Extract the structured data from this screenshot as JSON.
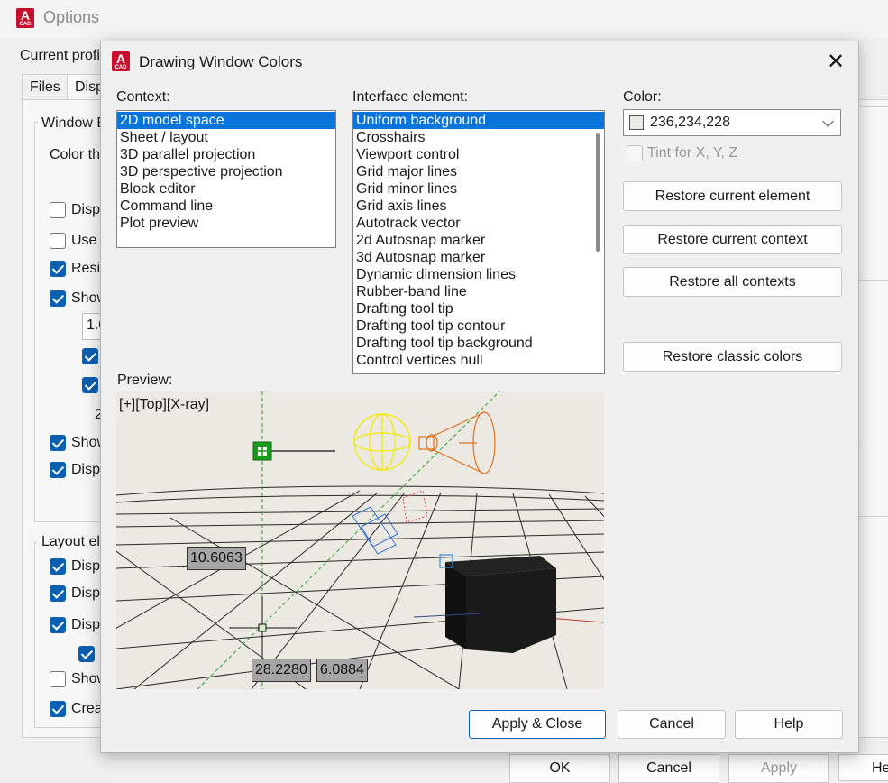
{
  "options_window": {
    "title": "Options",
    "current_profile_label": "Current profil",
    "tabs": [
      "Files",
      "Disp"
    ],
    "window_group_label": "Window E",
    "color_theme_label": "Color the",
    "window_rows": [
      {
        "label": "Disp",
        "checked": false
      },
      {
        "label": "Use",
        "checked": false
      },
      {
        "label": "Resi",
        "checked": true
      },
      {
        "label": "Show",
        "checked": true
      }
    ],
    "sub_value_1": "1.0",
    "sub_value_2": "2",
    "window_rows_2": [
      {
        "label": "Show",
        "checked": true
      },
      {
        "label": "Disp",
        "checked": true
      }
    ],
    "layout_group_label": "Layout ele",
    "layout_rows": [
      {
        "label": "Disp",
        "checked": true
      },
      {
        "label": "Disp",
        "checked": true
      },
      {
        "label": "Disp",
        "checked": true
      },
      {
        "label": "Show",
        "checked": false
      },
      {
        "label": "Crea",
        "checked": true
      }
    ],
    "buttons": {
      "ok": "OK",
      "cancel": "Cancel",
      "apply": "Apply",
      "help": "He"
    }
  },
  "dialog": {
    "title": "Drawing Window Colors",
    "context_label": "Context:",
    "contexts": [
      "2D model space",
      "Sheet / layout",
      "3D parallel projection",
      "3D perspective projection",
      "Block editor",
      "Command line",
      "Plot preview"
    ],
    "context_selected": 0,
    "interface_label": "Interface element:",
    "interface_elements": [
      "Uniform background",
      "Crosshairs",
      "Viewport control",
      "Grid major lines",
      "Grid minor lines",
      "Grid axis lines",
      "Autotrack vector",
      "2d Autosnap marker",
      "3d Autosnap marker",
      "Dynamic dimension lines",
      "Rubber-band line",
      "Drafting tool tip",
      "Drafting tool tip contour",
      "Drafting tool tip background",
      "Control vertices hull"
    ],
    "interface_selected": 0,
    "color_label": "Color:",
    "color_value": "236,234,228",
    "color_swatch": "#ECEAE4",
    "tint_label": "Tint for X, Y, Z",
    "tint_checked": false,
    "buttons": {
      "restore_element": "Restore current element",
      "restore_context": "Restore current context",
      "restore_all": "Restore all contexts",
      "restore_classic": "Restore classic colors",
      "apply_close": "Apply & Close",
      "cancel": "Cancel",
      "help": "Help"
    },
    "preview_label": "Preview:",
    "preview": {
      "viewport_label": "[+][Top][X-ray]",
      "dim_1": "10.6063",
      "dim_2": "28.2280",
      "dim_3": "6.0884",
      "colors": {
        "grid": "#2a2a2a",
        "y_axis": "#2ca02c",
        "x_axis": "#c0392b",
        "light": "#f2ea1e",
        "spot": "#e07020",
        "camera": "#3a6fd8",
        "cube": "#101010"
      }
    }
  }
}
